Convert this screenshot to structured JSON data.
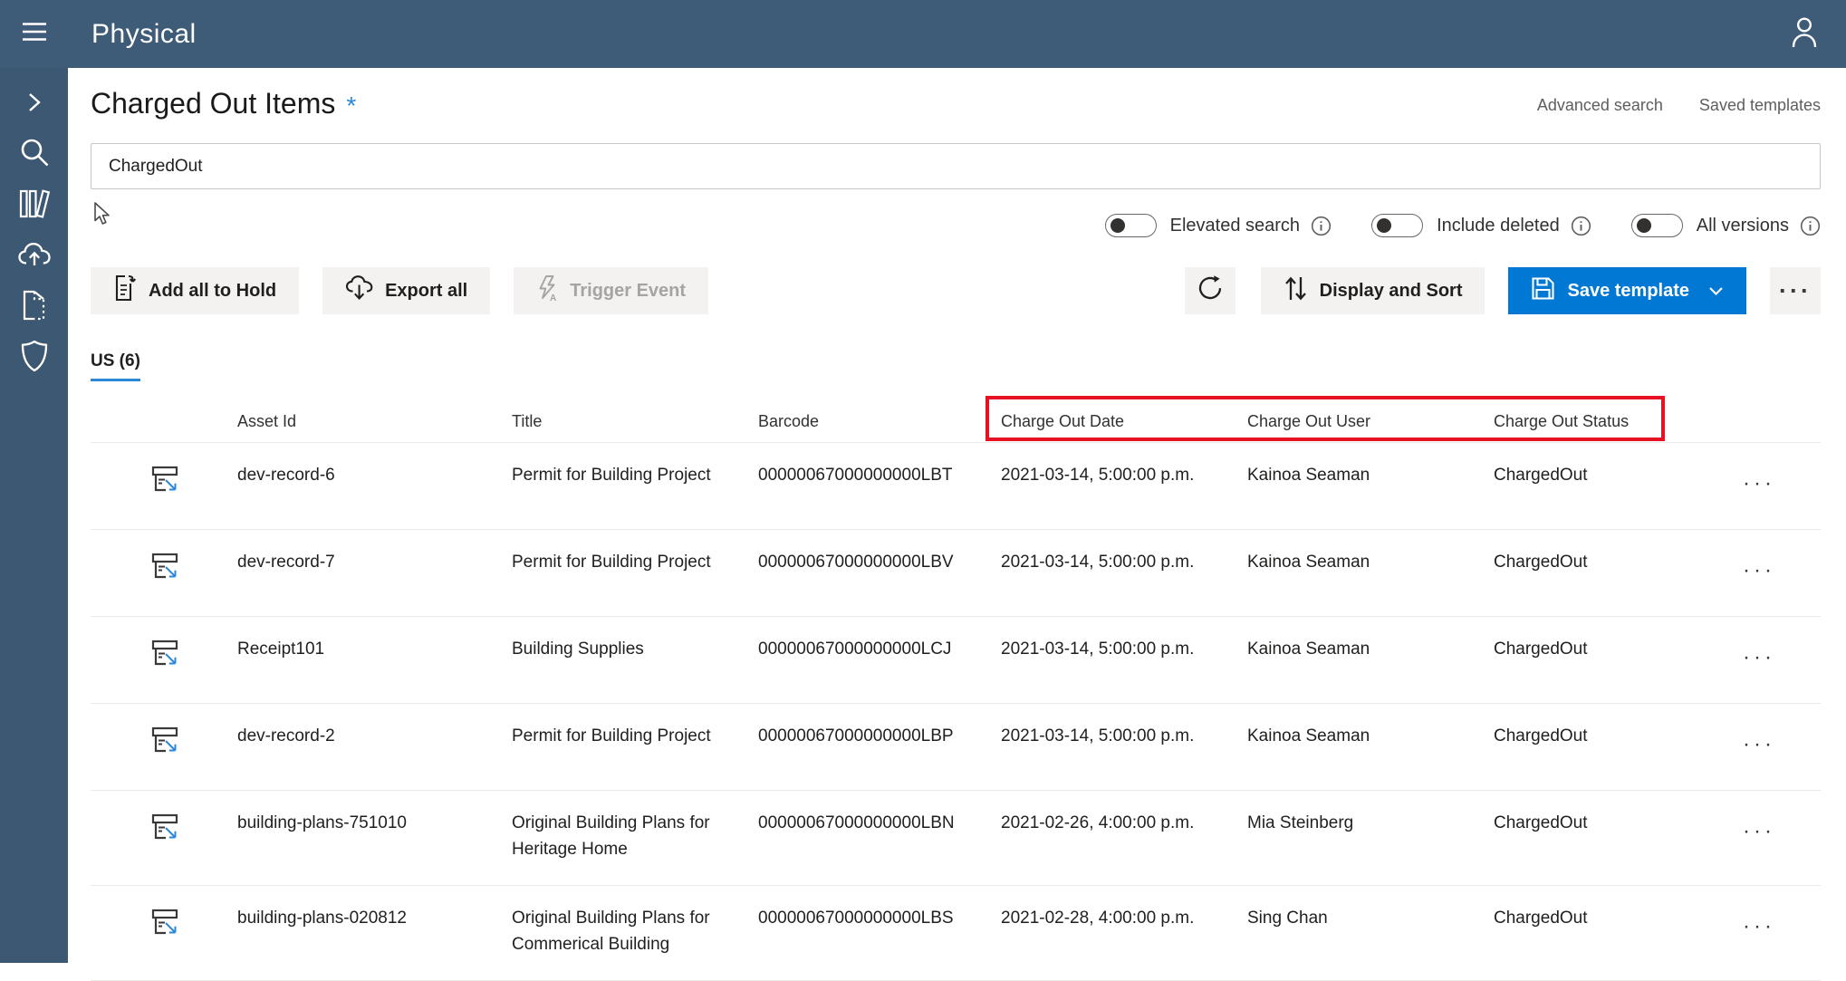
{
  "topbar": {
    "title": "Physical",
    "icons": [
      "hamburger-icon",
      "person-icon"
    ]
  },
  "sidebar": {
    "icons": [
      "chevron-right-icon",
      "search-icon",
      "library-icon",
      "cloud-upload-icon",
      "document-icon",
      "shield-icon"
    ]
  },
  "page": {
    "title": "Charged Out Items",
    "title_asterisk": "*",
    "links": {
      "advanced_search": "Advanced search",
      "saved_templates": "Saved templates"
    },
    "search": {
      "value": "ChargedOut"
    },
    "toggles": [
      {
        "label": "Elevated search",
        "state": "off"
      },
      {
        "label": "Include deleted",
        "state": "off"
      },
      {
        "label": "All versions",
        "state": "off"
      }
    ],
    "actions": {
      "add_all_to_hold": "Add all to Hold",
      "export_all": "Export all",
      "trigger_event": "Trigger Event",
      "display_and_sort": "Display and Sort",
      "save_template": "Save template",
      "more": "···"
    },
    "tab": {
      "label": "US (6)"
    }
  },
  "table": {
    "headers": {
      "asset_id": "Asset Id",
      "title": "Title",
      "barcode": "Barcode",
      "charge_out_date": "Charge Out Date",
      "charge_out_user": "Charge Out User",
      "charge_out_status": "Charge Out Status"
    },
    "row_more": "···",
    "rows": [
      {
        "asset_id": "dev-record-6",
        "title": "Permit for Building Project",
        "barcode": "00000067000000000LBT",
        "date": "2021-03-14, 5:00:00 p.m.",
        "user": "Kainoa Seaman",
        "status": "ChargedOut"
      },
      {
        "asset_id": "dev-record-7",
        "title": "Permit for Building Project",
        "barcode": "00000067000000000LBV",
        "date": "2021-03-14, 5:00:00 p.m.",
        "user": "Kainoa Seaman",
        "status": "ChargedOut"
      },
      {
        "asset_id": "Receipt101",
        "title": "Building Supplies",
        "barcode": "00000067000000000LCJ",
        "date": "2021-03-14, 5:00:00 p.m.",
        "user": "Kainoa Seaman",
        "status": "ChargedOut"
      },
      {
        "asset_id": "dev-record-2",
        "title": "Permit for Building Project",
        "barcode": "00000067000000000LBP",
        "date": "2021-03-14, 5:00:00 p.m.",
        "user": "Kainoa Seaman",
        "status": "ChargedOut"
      },
      {
        "asset_id": "building-plans-751010",
        "title": "Original Building Plans for Heritage Home",
        "barcode": "00000067000000000LBN",
        "date": "2021-02-26, 4:00:00 p.m.",
        "user": "Mia Steinberg",
        "status": "ChargedOut"
      },
      {
        "asset_id": "building-plans-020812",
        "title": "Original Building Plans for Commerical Building",
        "barcode": "00000067000000000LBS",
        "date": "2021-02-28, 4:00:00 p.m.",
        "user": "Sing Chan",
        "status": "ChargedOut"
      }
    ]
  },
  "colors": {
    "topbar": "#3e5c78",
    "sidebar": "#3d5872",
    "accent_blue": "#0078d4",
    "tab_underline": "#2b88d8",
    "annotation_red": "#e81123",
    "button_gray": "#f3f2f1"
  }
}
